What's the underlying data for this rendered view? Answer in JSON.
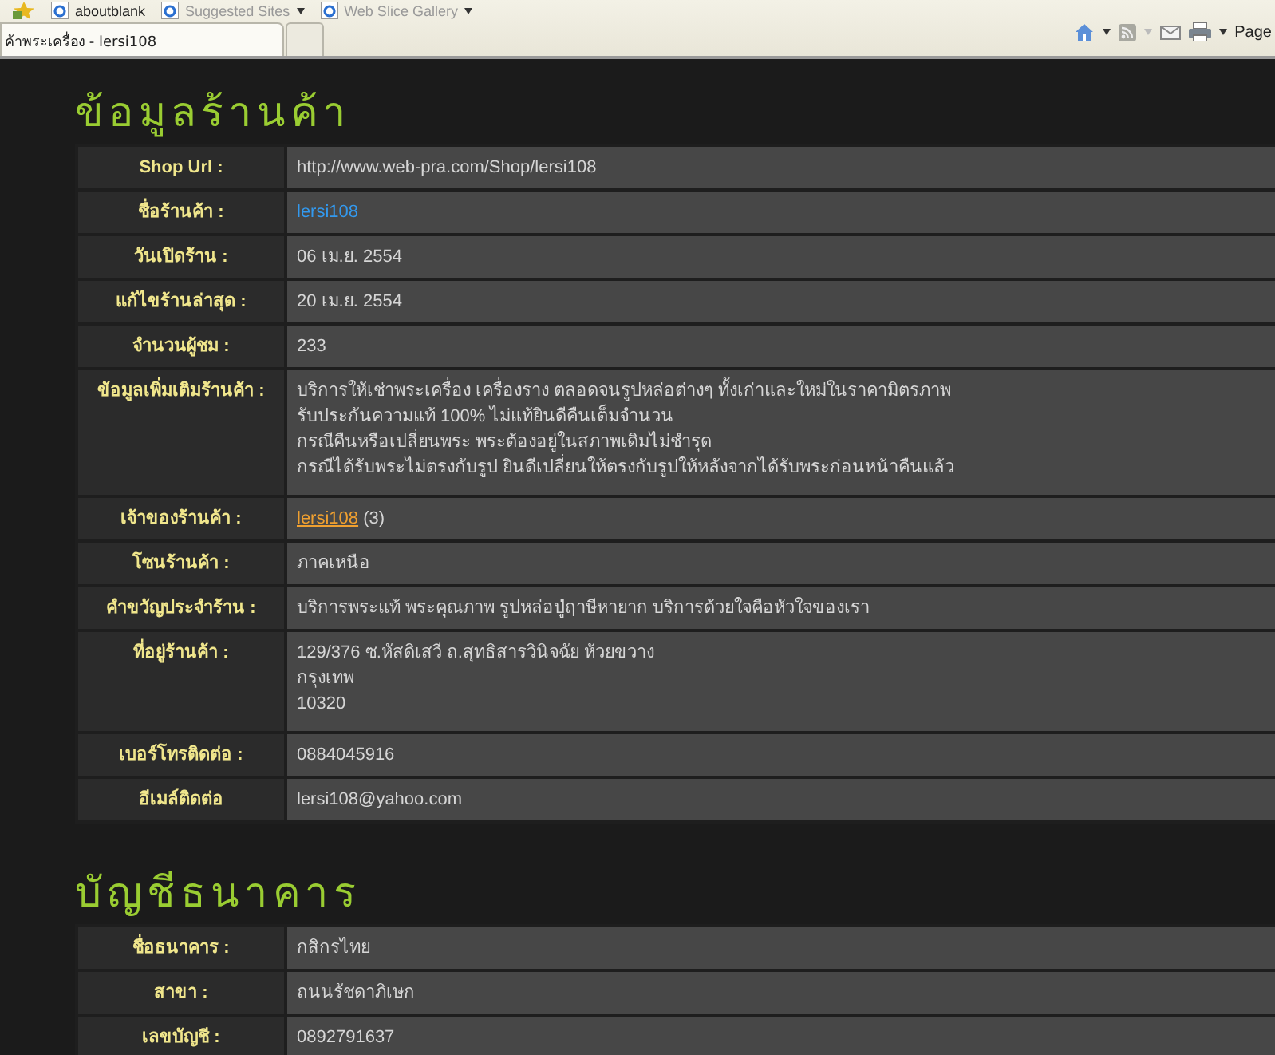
{
  "browser": {
    "favorites": [
      {
        "label": "aboutblank",
        "dropdown": false
      },
      {
        "label": "Suggested Sites",
        "dropdown": true
      },
      {
        "label": "Web Slice Gallery",
        "dropdown": true
      }
    ],
    "tab_title": "ค้าพระเครื่อง - lersi108",
    "page_menu": "Page"
  },
  "sections": [
    {
      "heading": "ข้อมูลร้านค้า",
      "rows": [
        {
          "label": "Shop Url :",
          "kind": "text",
          "value": "http://www.web-pra.com/Shop/lersi108"
        },
        {
          "label": "ชื่อร้านค้า :",
          "kind": "link",
          "value": "lersi108"
        },
        {
          "label": "วันเปิดร้าน :",
          "kind": "text",
          "value": "06 เม.ย. 2554"
        },
        {
          "label": "แก้ไขร้านล่าสุด :",
          "kind": "text",
          "value": "20 เม.ย. 2554"
        },
        {
          "label": "จำนวนผู้ชม :",
          "kind": "text",
          "value": "233"
        },
        {
          "label": "ข้อมูลเพิ่มเติมร้านค้า :",
          "kind": "lines",
          "lines": [
            "บริการให้เช่าพระเครื่อง เครื่องราง ตลอดจนรูปหล่อต่างๆ ทั้งเก่าและใหม่ในราคามิตรภาพ",
            "รับประกันความแท้ 100% ไม่แท้ยินดีคืนเต็มจำนวน",
            "กรณีคืนหรือเปลี่ยนพระ พระต้องอยู่ในสภาพเดิมไม่ชำรุด",
            "กรณีได้รับพระไม่ตรงกับรูป ยินดีเปลี่ยนให้ตรงกับรูปให้หลังจากได้รับพระก่อนหน้าคืนแล้ว"
          ]
        },
        {
          "label": "เจ้าของร้านค้า :",
          "kind": "owner",
          "value": "lersi108",
          "count": "(3)"
        },
        {
          "label": "โซนร้านค้า :",
          "kind": "text",
          "value": "ภาคเหนือ"
        },
        {
          "label": "คำขวัญประจำร้าน :",
          "kind": "text",
          "value": "บริการพระแท้ พระคุณภาพ รูปหล่อปู่ฤาษีหายาก บริการด้วยใจคือหัวใจของเรา"
        },
        {
          "label": "ที่อยู่ร้านค้า :",
          "kind": "lines",
          "lines": [
            "129/376 ซ.หัสดิเสวี ถ.สุทธิสารวินิจฉัย ห้วยขวาง",
            "กรุงเทพ",
            "10320"
          ]
        },
        {
          "label": "เบอร์โทรติดต่อ :",
          "kind": "text",
          "value": "0884045916"
        },
        {
          "label": "อีเมล์ติดต่อ",
          "kind": "text",
          "value": "lersi108@yahoo.com"
        }
      ]
    },
    {
      "heading": "บัญชีธนาคาร",
      "rows": [
        {
          "label": "ชื่อธนาคาร :",
          "kind": "text",
          "value": "กสิกรไทย"
        },
        {
          "label": "สาขา :",
          "kind": "text",
          "value": "ถนนรัชดาภิเษก"
        },
        {
          "label": "เลขบัญชี :",
          "kind": "text",
          "value": "0892791637"
        }
      ]
    }
  ]
}
